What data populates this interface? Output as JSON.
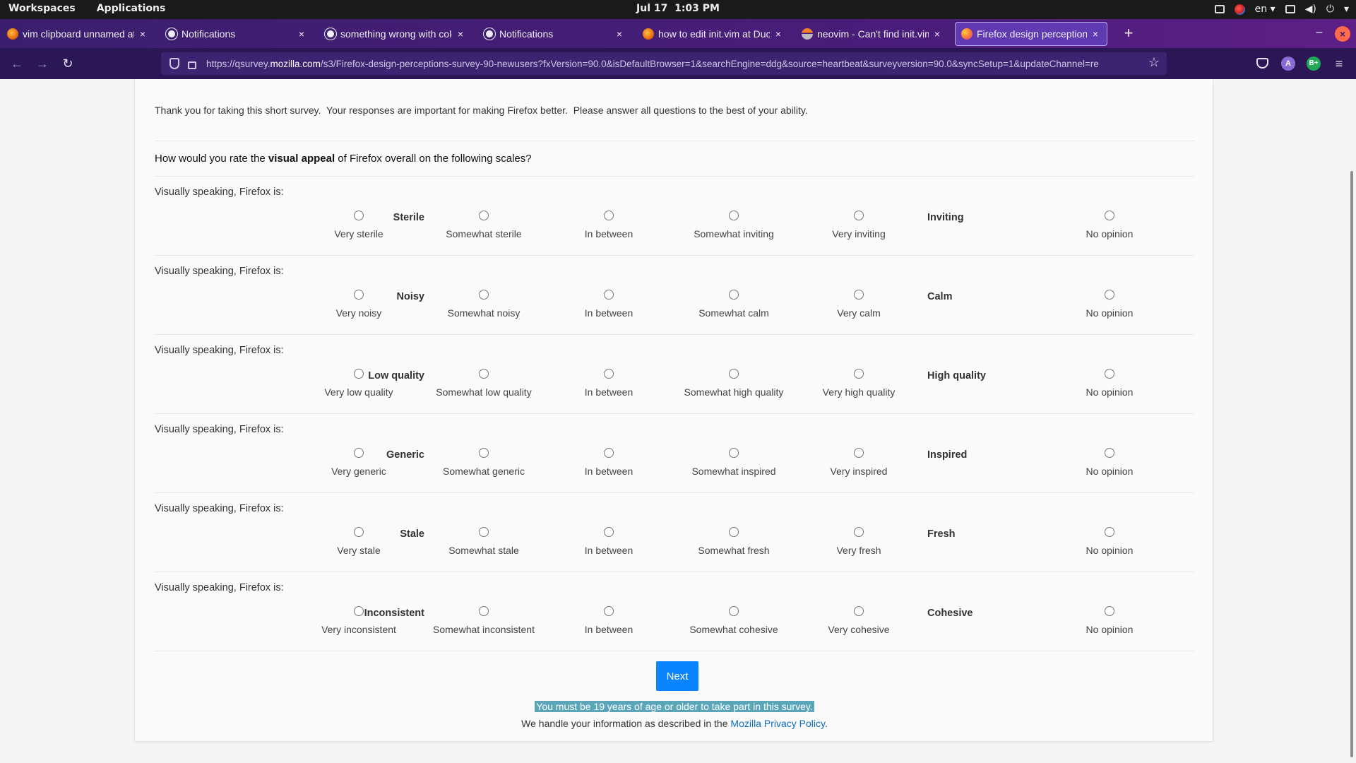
{
  "topbar": {
    "workspaces": "Workspaces",
    "applications": "Applications",
    "clock": "Jul 17  1:03 PM",
    "lang": "en",
    "icons": [
      "display-icon",
      "chrome-icon",
      "keyboard-icon",
      "volume-icon",
      "power-icon"
    ]
  },
  "tabs": [
    {
      "title": "vim clipboard unnamed at DuckDuckGo",
      "favicon": "duckduckgo-icon"
    },
    {
      "title": "Notifications",
      "favicon": "github-icon"
    },
    {
      "title": "something wrong with colorscheme",
      "favicon": "github-icon"
    },
    {
      "title": "Notifications",
      "favicon": "github-icon"
    },
    {
      "title": "how to edit init.vim at DuckDuckGo",
      "favicon": "duckduckgo-icon"
    },
    {
      "title": "neovim - Can't find init.vim",
      "favicon": "stackoverflow-icon"
    },
    {
      "title": "Firefox design perceptions survey",
      "favicon": "firefox-icon",
      "active": true
    }
  ],
  "urlbar": {
    "prefix": "https://qsurvey.",
    "host": "mozilla.com",
    "path": "/s3/Firefox-design-perceptions-survey-90-newusers?fxVersion=90.0&isDefaultBrowser=1&searchEngine=ddg&source=heartbeat&surveyversion=90.0&syncSetup=1&updateChannel=re"
  },
  "toolbar": {
    "avatar": "A",
    "extension": "B+"
  },
  "survey": {
    "intro": "Thank you for taking this short survey.  Your responses are important for making Firefox better.  Please answer all questions to the best of your ability.",
    "question_pre": "How would you rate the ",
    "question_bold": "visual appeal",
    "question_post": " of Firefox overall on the following scales?",
    "prompt": "Visually speaking, Firefox is:",
    "no_opinion": "No opinion",
    "rows": [
      {
        "left": "Sterile",
        "right": "Inviting",
        "options": [
          "Very sterile",
          "Somewhat sterile",
          "In between",
          "Somewhat inviting",
          "Very inviting"
        ]
      },
      {
        "left": "Noisy",
        "right": "Calm",
        "options": [
          "Very noisy",
          "Somewhat noisy",
          "In between",
          "Somewhat calm",
          "Very calm"
        ]
      },
      {
        "left": "Low quality",
        "right": "High quality",
        "options": [
          "Very low quality",
          "Somewhat low quality",
          "In between",
          "Somewhat high quality",
          "Very high quality"
        ]
      },
      {
        "left": "Generic",
        "right": "Inspired",
        "options": [
          "Very generic",
          "Somewhat generic",
          "In between",
          "Somewhat inspired",
          "Very inspired"
        ]
      },
      {
        "left": "Stale",
        "right": "Fresh",
        "options": [
          "Very stale",
          "Somewhat stale",
          "In between",
          "Somewhat fresh",
          "Very fresh"
        ]
      },
      {
        "left": "Inconsistent",
        "right": "Cohesive",
        "options": [
          "Very inconsistent",
          "Somewhat inconsistent",
          "In between",
          "Somewhat cohesive",
          "Very cohesive"
        ]
      }
    ],
    "next_label": "Next",
    "age_note": "You must be 19 years of age or older to take part in this survey.",
    "privacy_pre": "We handle your information as described in the ",
    "privacy_link": "Mozilla Privacy Policy",
    "privacy_post": "."
  }
}
